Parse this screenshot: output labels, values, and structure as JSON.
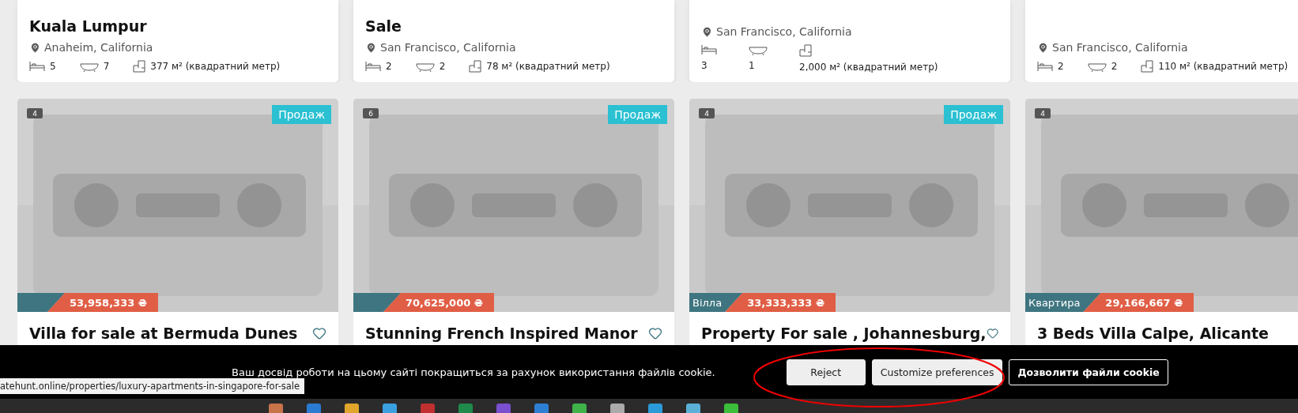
{
  "top_cards": [
    {
      "kind": "inline",
      "title": "Kuala Lumpur",
      "location": "Anaheim, California",
      "beds": "5",
      "baths": "7",
      "area": "377 м² (квадратний метр)"
    },
    {
      "kind": "inline",
      "title": "Sale",
      "location": "San Francisco, California",
      "beds": "2",
      "baths": "2",
      "area": "78 м² (квадратний метр)"
    },
    {
      "kind": "stacked",
      "location": "San Francisco, California",
      "beds": "3",
      "baths": "1",
      "area": "2,000 м² (квадратний метр)"
    },
    {
      "kind": "inline",
      "location": "San Francisco, California",
      "beds": "2",
      "baths": "2",
      "area": "110 м² (квадратний метр)"
    }
  ],
  "listing_cards": [
    {
      "photo_count": "4",
      "status": "Продаж",
      "price": "53,958,333 ₴",
      "title": "Villa for sale at Bermuda Dunes",
      "favorite": false
    },
    {
      "photo_count": "6",
      "status": "Продаж",
      "price": "70,625,000 ₴",
      "title": "Stunning French Inspired Manor",
      "favorite": false
    },
    {
      "photo_count": "4",
      "status": "Продаж",
      "type": "Вілла",
      "price": "33,333,333 ₴",
      "title": "Property For sale , Johannesburg,",
      "favorite": false
    },
    {
      "photo_count": "4",
      "type": "Квартира",
      "price": "29,166,667 ₴",
      "title": "3 Beds Villa Calpe, Alicante"
    }
  ],
  "cookie_banner": {
    "message": "Ваш досвід роботи на цьому сайті покращиться за рахунок використання файлів cookie.",
    "buttons": [
      {
        "label": "Reject",
        "kind": "plain"
      },
      {
        "label": "Customize preferences",
        "kind": "plain"
      },
      {
        "label": "Дозволити файли cookie",
        "kind": "outline"
      }
    ]
  },
  "status_bar": {
    "url": "atehunt.online/properties/luxury-apartments-in-singapore-for-sale"
  }
}
